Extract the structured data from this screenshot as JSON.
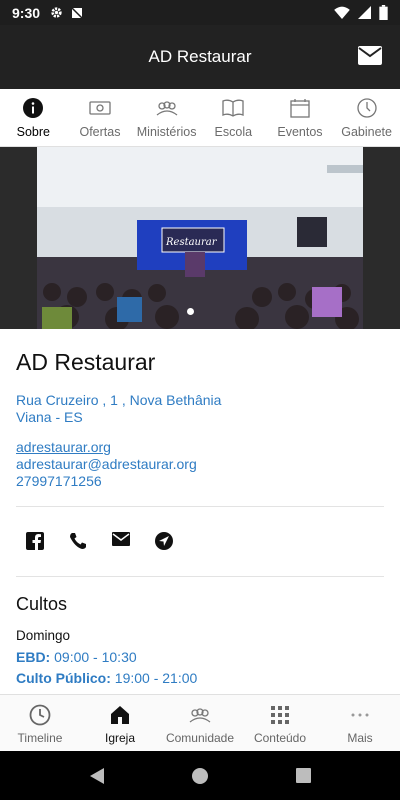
{
  "status": {
    "time": "9:30"
  },
  "app_bar": {
    "title": "AD Restaurar"
  },
  "tabs": [
    {
      "label": "Sobre",
      "icon": "info-icon"
    },
    {
      "label": "Ofertas",
      "icon": "money-icon"
    },
    {
      "label": "Ministérios",
      "icon": "group-icon"
    },
    {
      "label": "Escola",
      "icon": "book-icon"
    },
    {
      "label": "Eventos",
      "icon": "calendar-icon"
    },
    {
      "label": "Gabinete",
      "icon": "clock-icon"
    }
  ],
  "hero": {
    "banner_text": "Restaurar"
  },
  "church": {
    "name": "AD Restaurar",
    "address_line1": "Rua Cruzeiro , 1 , Nova Bethânia",
    "address_line2": "Viana - ES",
    "website": "adrestaurar.org",
    "email": "adrestaurar@adrestaurar.org",
    "phone": "27997171256"
  },
  "cultos": {
    "title": "Cultos",
    "day": "Domingo",
    "items": [
      {
        "label": "EBD:",
        "time": "09:00 - 10:30"
      },
      {
        "label": "Culto Público:",
        "time": "19:00 - 21:00"
      }
    ]
  },
  "bottom_nav": [
    {
      "label": "Timeline",
      "icon": "clock-icon"
    },
    {
      "label": "Igreja",
      "icon": "church-icon"
    },
    {
      "label": "Comunidade",
      "icon": "community-icon"
    },
    {
      "label": "Conteúdo",
      "icon": "grid-icon"
    },
    {
      "label": "Mais",
      "icon": "more-icon"
    }
  ]
}
